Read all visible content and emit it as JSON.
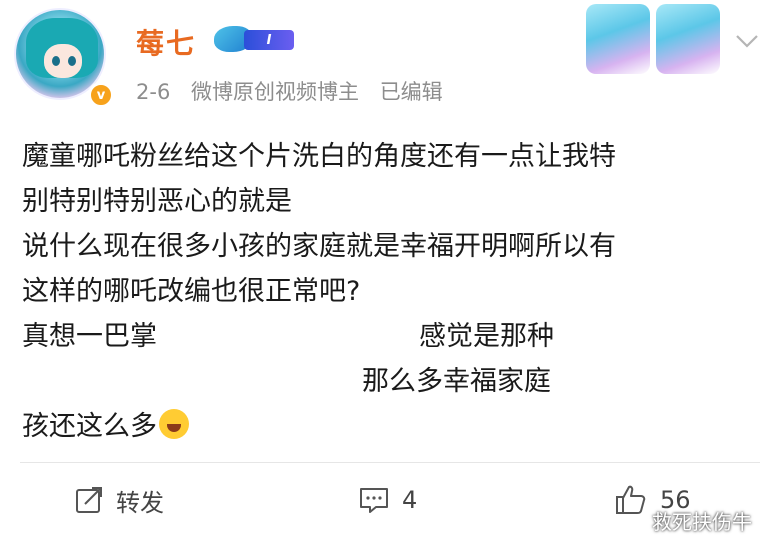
{
  "post": {
    "username": "莓七",
    "level_badge": "I",
    "verified_badge": "v",
    "date": "2-6",
    "role": "微博原创视频博主",
    "edited": "已编辑",
    "content": {
      "line1": "魔童哪吒粉丝给这个片洗白的角度还有一点让我特",
      "line2": "别特别特别恶心的就是",
      "line3": "说什么现在很多小孩的家庭就是幸福开明啊所以有",
      "line4": "这样的哪吒改编也很正常吧?",
      "line5_start": "真想一巴掌",
      "line5_end": "感觉是那种",
      "line6_end": "那么多幸福家庭",
      "line7": "孩还这么多"
    },
    "actions": {
      "repost": "转发",
      "comment_count": "4",
      "like_count": "56"
    },
    "watermark": "救死扶伤牛"
  },
  "icons": {
    "chevron": "chevron-down-icon",
    "repost": "repost-icon",
    "comment": "comment-icon",
    "like": "thumbs-up-icon",
    "emoji": "laughing-tears-emoji"
  },
  "colors": {
    "username": "#e86a21",
    "meta": "#8d8d8d",
    "verified": "#f7a21b"
  }
}
